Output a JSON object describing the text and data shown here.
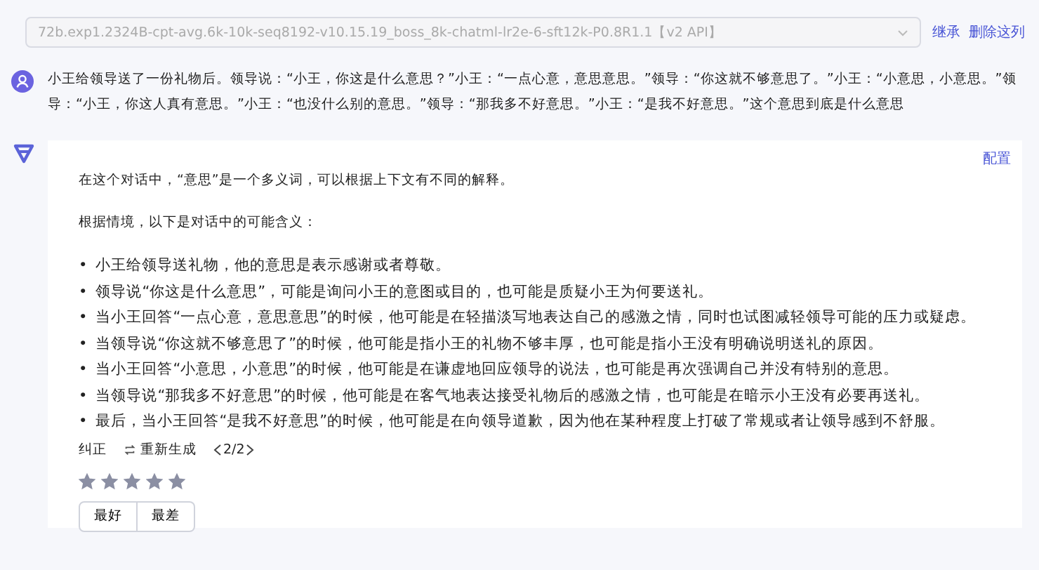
{
  "model_select": {
    "value": "72b.exp1.2324B-cpt-avg.6k-10k-seq8192-v10.15.19_boss_8k-chatml-lr2e-6-sft12k-P0.8R1.1【v2 API】",
    "disabled": true
  },
  "header_links": [
    "继承",
    "删除这列"
  ],
  "question": "小王给领导送了一份礼物后。领导说：“小王，你这是什么意思？”小王：“一点心意，意思意思。”领导：“你这就不够意思了。”小王：“小意思，小意思。”领导：“小王，你这人真有意思。”小王：“也没什么别的意思。”领导：“那我多不好意思。”小王：“是我不好意思。”这个意思到底是什么意思",
  "answer": {
    "config_link": "配置",
    "paragraphs": [
      "在这个对话中，“意思”是一个多义词，可以根据上下文有不同的解释。",
      "根据情境，以下是对话中的可能含义："
    ],
    "bullets": [
      "小王给领导送礼物，他的意思是表示感谢或者尊敬。",
      "领导说“你这是什么意思”，可能是询问小王的意图或目的，也可能是质疑小王为何要送礼。",
      "当小王回答“一点心意，意思意思”的时候，他可能是在轻描淡写地表达自己的感激之情，同时也试图减轻领导可能的压力或疑虑。",
      "当领导说“你这就不够意思了”的时候，他可能是指小王的礼物不够丰厚，也可能是指小王没有明确说明送礼的原因。",
      "当小王回答“小意思，小意思”的时候，他可能是在谦虚地回应领导的说法，也可能是再次强调自己并没有特别的意思。",
      "当领导说“那我多不好意思”的时候，他可能是在客气地表达接受礼物后的感激之情，也可能是在暗示小王没有必要再送礼。",
      "最后，当小王回答“是我不好意思”的时候，他可能是在向领导道歉，因为他在某种程度上打破了常规或者让领导感到不舒服。"
    ],
    "actions": {
      "correct": "纠正",
      "regenerate": "重新生成",
      "pager": "2/2"
    },
    "bullet_marker": "•",
    "stars": 5,
    "rank_buttons": [
      "最好",
      "最差"
    ]
  }
}
